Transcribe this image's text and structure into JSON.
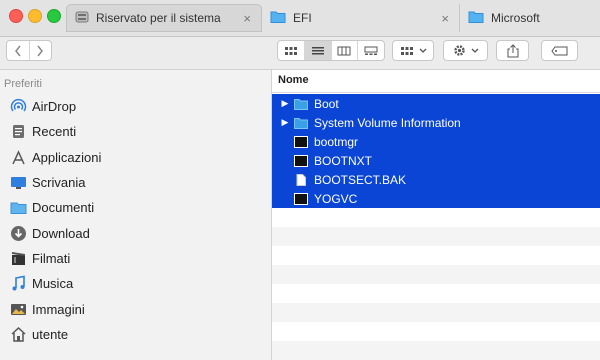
{
  "tabs": [
    {
      "label": "Riservato per il sistema",
      "icon": "drive-icon"
    },
    {
      "label": "EFI",
      "icon": "folder-icon"
    },
    {
      "label": "Microsoft",
      "icon": "folder-icon"
    }
  ],
  "tab_close": "×",
  "sidebar": {
    "section": "Preferiti",
    "items": [
      {
        "label": "AirDrop",
        "icon": "airdrop-icon"
      },
      {
        "label": "Recenti",
        "icon": "recents-icon"
      },
      {
        "label": "Applicazioni",
        "icon": "applications-icon"
      },
      {
        "label": "Scrivania",
        "icon": "desktop-icon"
      },
      {
        "label": "Documenti",
        "icon": "documents-icon"
      },
      {
        "label": "Download",
        "icon": "download-icon"
      },
      {
        "label": "Filmati",
        "icon": "movies-icon"
      },
      {
        "label": "Musica",
        "icon": "music-icon"
      },
      {
        "label": "Immagini",
        "icon": "pictures-icon"
      },
      {
        "label": "utente",
        "icon": "home-icon"
      }
    ]
  },
  "list": {
    "column_header": "Nome",
    "rows": [
      {
        "name": "Boot",
        "kind": "folder",
        "expandable": true,
        "selected": true
      },
      {
        "name": "System Volume Information",
        "kind": "folder",
        "expandable": true,
        "selected": true
      },
      {
        "name": "bootmgr",
        "kind": "exec",
        "expandable": false,
        "selected": true
      },
      {
        "name": "BOOTNXT",
        "kind": "exec",
        "expandable": false,
        "selected": true
      },
      {
        "name": "BOOTSECT.BAK",
        "kind": "document",
        "expandable": false,
        "selected": true
      },
      {
        "name": "YOGVC",
        "kind": "exec",
        "expandable": false,
        "selected": true
      }
    ]
  },
  "colors": {
    "selection": "#0a45d6",
    "folder": "#3aa0e8",
    "sidebar_icon": "#2f7fe0"
  }
}
